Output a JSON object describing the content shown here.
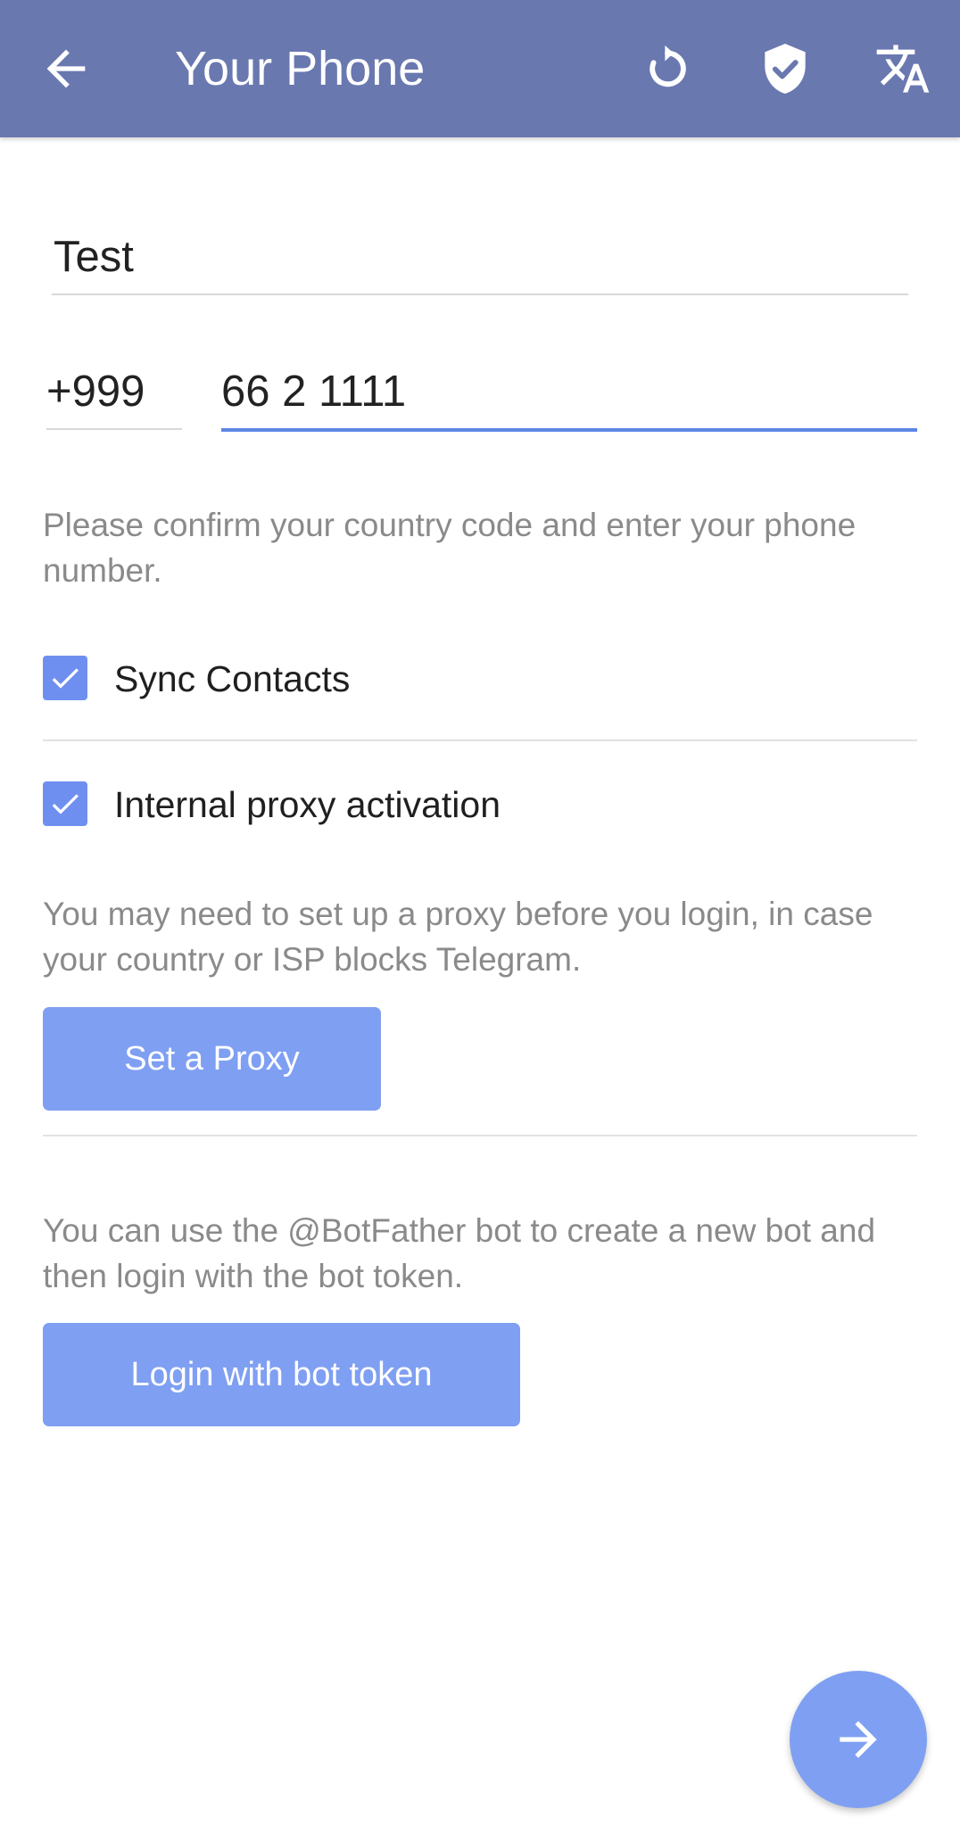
{
  "toolbar": {
    "title": "Your Phone",
    "back_icon": "arrow-left-icon",
    "reload_icon": "reload-icon",
    "shield_icon": "shield-check-icon",
    "translate_icon": "translate-icon",
    "background_color": "#6a78b0"
  },
  "form": {
    "name_value": "Test",
    "country_code": "+999",
    "phone_number": "66 2 1111",
    "phone_hint": "Please confirm your country code and enter your phone number.",
    "active_underline_color": "#5c86e6"
  },
  "options": {
    "sync_contacts_label": "Sync Contacts",
    "sync_contacts_checked": true,
    "internal_proxy_label": "Internal proxy activation",
    "internal_proxy_checked": true
  },
  "proxy": {
    "hint": "You may need to set up a proxy before you login, in case your country or ISP blocks Telegram.",
    "button_label": "Set a Proxy"
  },
  "bot": {
    "hint": "You can use the @BotFather bot to create a new bot and then login with the bot token.",
    "button_label": "Login with bot token"
  },
  "fab": {
    "icon": "arrow-right-icon",
    "color": "#7f9ff2"
  }
}
